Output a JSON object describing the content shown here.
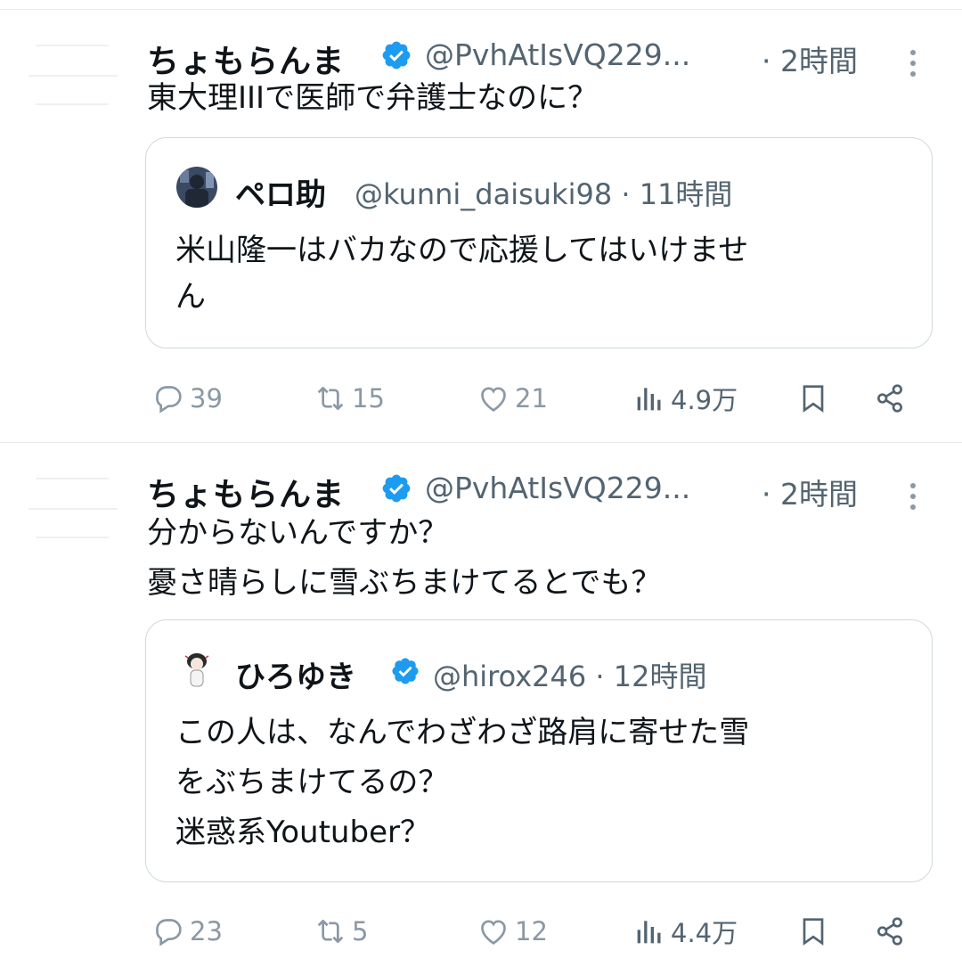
{
  "tweets": [
    {
      "name": "ちょもらんま",
      "handle": "@PvhAtIsVQ229...",
      "time": "· 2時間",
      "text": "東大理IIIで医師で弁護士なのに？",
      "quote": {
        "name": "ペロ助",
        "handle": "@kunni_daisuki98 · 11時間",
        "text_lines": [
          "米山隆一はバカなので応援してはいけませ",
          "ん"
        ]
      },
      "replies": "39",
      "retweets": "15",
      "likes": "21",
      "views": "4.9万"
    },
    {
      "name": "ちょもらんま",
      "handle": "@PvhAtIsVQ229...",
      "time": "· 2時間",
      "text_lines": [
        "分からないんですか？",
        "憂さ晴らしに雪ぶちまけてるとでも？"
      ],
      "quote": {
        "name": "ひろゆき",
        "handle": "@hirox246 · 12時間",
        "text_lines": [
          "この人は、なんでわざわざ路肩に寄せた雪",
          "をぶちまけてるの？",
          "迷惑系Youtuber？"
        ]
      },
      "replies": "23",
      "retweets": "5",
      "likes": "12",
      "views": "4.4万"
    }
  ],
  "colors": {
    "verified": "#1d9bf0",
    "muted": "#536471",
    "icon": "#8b98a5",
    "border": "#cfd9de"
  },
  "icons": [
    "verified-badge-icon",
    "more-icon",
    "reply-icon",
    "retweet-icon",
    "like-icon",
    "views-icon",
    "bookmark-icon",
    "share-icon"
  ]
}
